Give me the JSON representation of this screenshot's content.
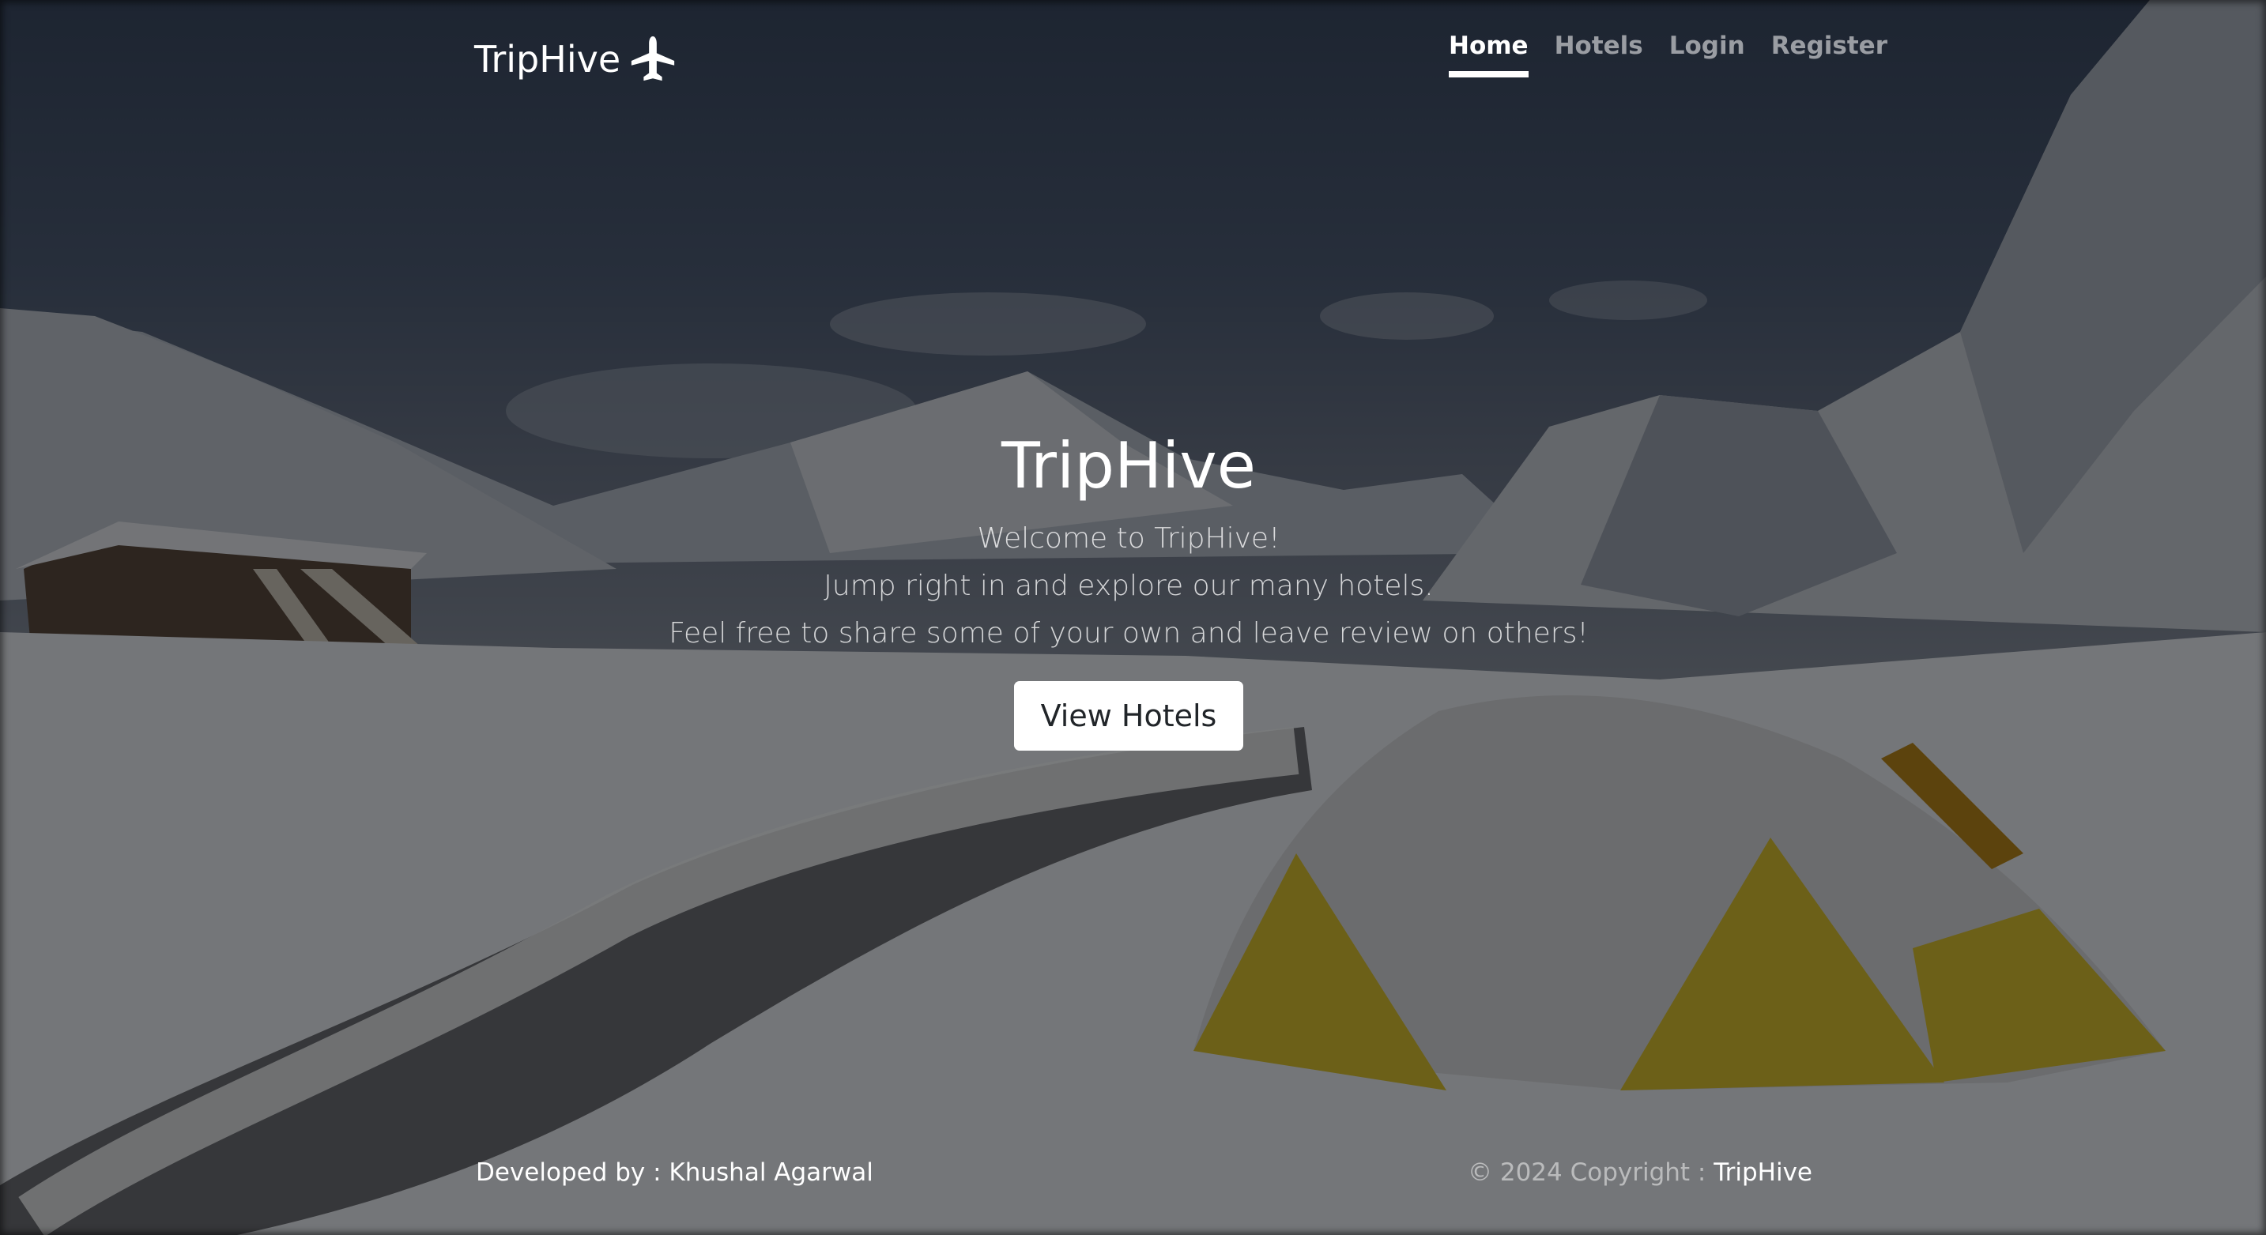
{
  "header": {
    "brand": "TripHive",
    "brand_icon": "airplane-icon",
    "nav": [
      {
        "label": "Home",
        "active": true
      },
      {
        "label": "Hotels",
        "active": false
      },
      {
        "label": "Login",
        "active": false
      },
      {
        "label": "Register",
        "active": false
      }
    ]
  },
  "hero": {
    "title": "TripHive",
    "lines": [
      "Welcome to TripHive!",
      "Jump right in and explore our many hotels.",
      "Feel free to share some of your own and leave review on others!"
    ],
    "button_label": "View Hotels"
  },
  "footer": {
    "developed_by": "Developed by : Khushal Agarwal",
    "copyright_prefix": "© 2024 Copyright : ",
    "copyright_brand": "TripHive"
  },
  "colors": {
    "overlay": "#000000",
    "text": "#ffffff",
    "button_bg": "#ffffff",
    "button_text": "#212529"
  }
}
